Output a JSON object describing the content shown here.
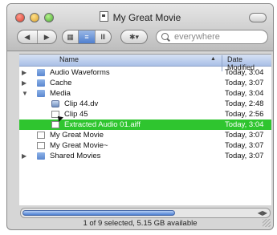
{
  "window": {
    "title": "My Great Movie",
    "search_placeholder": "everywhere"
  },
  "toolbar": {
    "back_label": "◀",
    "forward_label": "▶",
    "icon_view_label": "▦",
    "list_view_label": "≡",
    "column_view_label": "Ⅲ",
    "action_label": "✱▾"
  },
  "columns": {
    "name": "Name",
    "date": "Date Modified"
  },
  "rows": [
    {
      "name": "Audio Waveforms",
      "date": "Today, 3:04",
      "kind": "folder",
      "expanded": false,
      "selected": false
    },
    {
      "name": "Cache",
      "date": "Today, 3:07",
      "kind": "folder",
      "expanded": false,
      "selected": false
    },
    {
      "name": "Media",
      "date": "Today, 3:04",
      "kind": "folder",
      "expanded": true,
      "selected": false
    },
    {
      "name": "Clip 44.dv",
      "date": "Today, 2:48",
      "kind": "clip",
      "selected": false
    },
    {
      "name": "Clip 45",
      "date": "Today, 2:56",
      "kind": "file",
      "selected": false
    },
    {
      "name": "Extracted Audio 01.aiff",
      "date": "Today, 3:04",
      "kind": "file",
      "selected": true
    },
    {
      "name": "My Great Movie",
      "date": "Today, 3:07",
      "kind": "file",
      "selected": false
    },
    {
      "name": "My Great Movie~",
      "date": "Today, 3:07",
      "kind": "file",
      "selected": false
    },
    {
      "name": "Shared Movies",
      "date": "Today, 3:07",
      "kind": "folder",
      "expanded": false,
      "selected": false
    }
  ],
  "status": "1 of 9 selected, 5.15 GB available",
  "colors": {
    "selection": "#2fc52f",
    "accent": "#4f7fcf"
  }
}
